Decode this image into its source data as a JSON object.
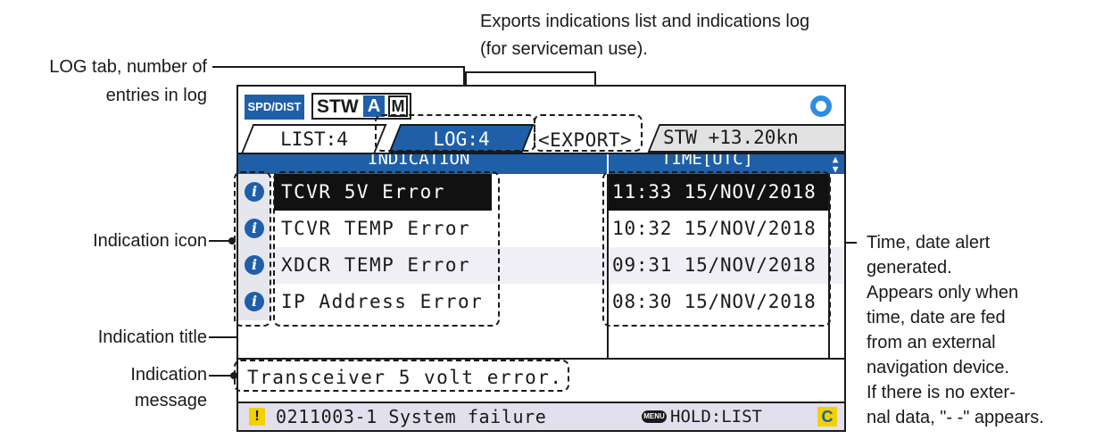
{
  "callouts": {
    "export_line1": "Exports indications list and indications log",
    "export_line2": "(for serviceman use).",
    "log_tab_line1": "LOG tab, number of",
    "log_tab_line2": "entries in log",
    "indication_icon": "Indication icon",
    "indication_title": "Indication title",
    "indication_message_line1": "Indication",
    "indication_message_line2": "message",
    "time_lines": [
      "Time, date alert",
      "generated.",
      "Appears only when",
      "time, date are fed",
      "from an external",
      "navigation device.",
      "If there is no exter-",
      "nal data, \"- -\" appears."
    ]
  },
  "screen": {
    "spd_badge": "SPD/DIST",
    "mode_stw": "STW",
    "mode_a": "A",
    "mode_m": "M",
    "tabs": {
      "list": "LIST:4",
      "log": "LOG:4",
      "export": "<EXPORT>",
      "stw": "STW +13.20kn"
    },
    "columns": {
      "indication": "INDICATION",
      "time": "TIME[UTC]"
    },
    "rows": [
      {
        "icon": "info-icon",
        "title": "TCVR 5V Error",
        "time": "11:33 15/NOV/2018"
      },
      {
        "icon": "info-icon",
        "title": "TCVR TEMP Error",
        "time": "10:32 15/NOV/2018"
      },
      {
        "icon": "info-icon",
        "title": "XDCR TEMP Error",
        "time": "09:31 15/NOV/2018"
      },
      {
        "icon": "info-icon",
        "title": "IP Address Error",
        "time": "08:30 15/NOV/2018"
      }
    ],
    "message": "Transceiver 5 volt error.",
    "status": {
      "warn_glyph": "!",
      "text": "0211003-1 System failure",
      "menu_label": "MENU",
      "hold": "HOLD:LIST",
      "c_badge": "C"
    }
  },
  "colors": {
    "accent_blue": "#1f5fa8",
    "ring_blue": "#2e8de0",
    "warning_yellow": "#f3d000"
  }
}
